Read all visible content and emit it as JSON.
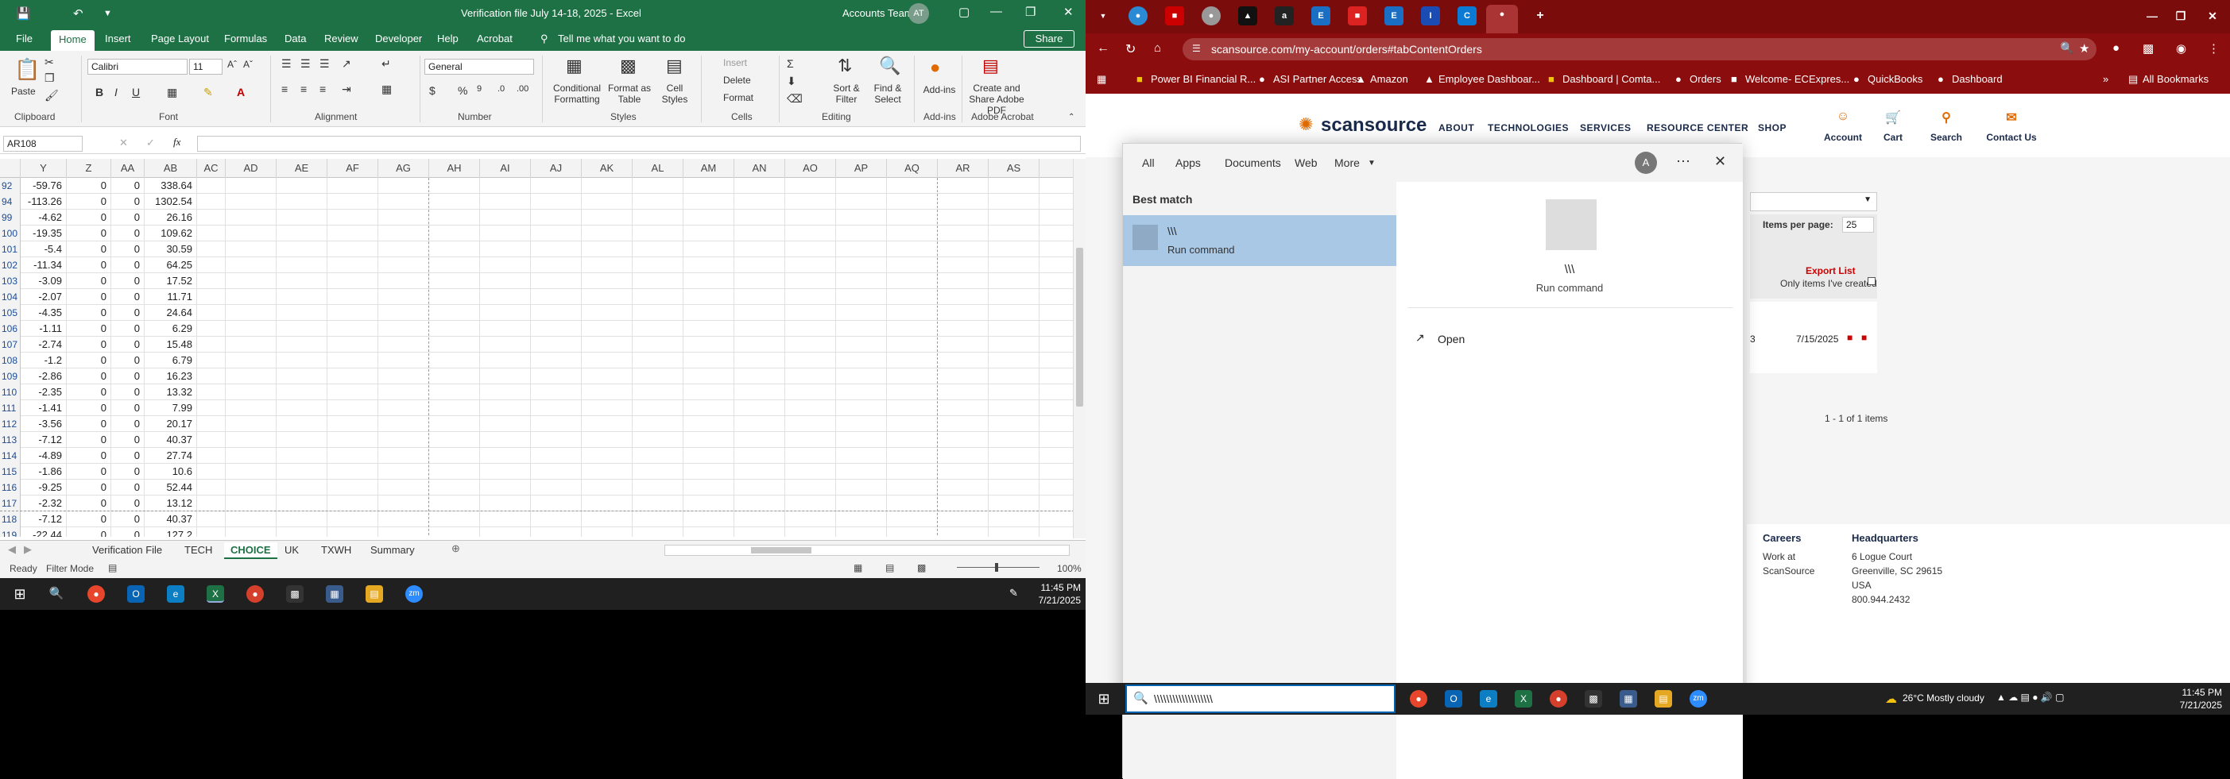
{
  "excel": {
    "title": "Verification file July 14-18, 2025  -  Excel",
    "user": "Accounts Team",
    "avatar": "AT",
    "tabs": [
      "File",
      "Home",
      "Insert",
      "Page Layout",
      "Formulas",
      "Data",
      "Review",
      "Developer",
      "Help",
      "Acrobat"
    ],
    "tell_me": "Tell me what you want to do",
    "share": "Share",
    "ribbon": {
      "font_name": "Calibri",
      "font_size": "11",
      "number_format": "General",
      "groups": [
        "Clipboard",
        "Font",
        "Alignment",
        "Number",
        "Styles",
        "Cells",
        "Editing",
        "Add-ins",
        "Adobe Acrobat"
      ],
      "paste": "Paste",
      "conditional": "Conditional Formatting",
      "format_as_table": "Format as Table",
      "cell_styles": "Cell Styles",
      "insert": "Insert",
      "delete": "Delete",
      "format": "Format",
      "sort_filter": "Sort & Filter",
      "find_select": "Find & Select",
      "addins": "Add-ins",
      "create_pdf": "Create and Share Adobe PDF"
    },
    "name_box": "AR108",
    "columns": [
      "Y",
      "Z",
      "AA",
      "AB",
      "AC",
      "AD",
      "AE",
      "AF",
      "AG",
      "AH",
      "AI",
      "AJ",
      "AK",
      "AL",
      "AM",
      "AN",
      "AO",
      "AP",
      "AQ",
      "AR",
      "AS"
    ],
    "rows": [
      {
        "n": "92",
        "y": "-59.76",
        "z": "0",
        "aa": "0",
        "ab": "338.64"
      },
      {
        "n": "94",
        "y": "-113.26",
        "z": "0",
        "aa": "0",
        "ab": "1302.54"
      },
      {
        "n": "99",
        "y": "-4.62",
        "z": "0",
        "aa": "0",
        "ab": "26.16"
      },
      {
        "n": "100",
        "y": "-19.35",
        "z": "0",
        "aa": "0",
        "ab": "109.62"
      },
      {
        "n": "101",
        "y": "-5.4",
        "z": "0",
        "aa": "0",
        "ab": "30.59"
      },
      {
        "n": "102",
        "y": "-11.34",
        "z": "0",
        "aa": "0",
        "ab": "64.25"
      },
      {
        "n": "103",
        "y": "-3.09",
        "z": "0",
        "aa": "0",
        "ab": "17.52"
      },
      {
        "n": "104",
        "y": "-2.07",
        "z": "0",
        "aa": "0",
        "ab": "11.71"
      },
      {
        "n": "105",
        "y": "-4.35",
        "z": "0",
        "aa": "0",
        "ab": "24.64"
      },
      {
        "n": "106",
        "y": "-1.11",
        "z": "0",
        "aa": "0",
        "ab": "6.29"
      },
      {
        "n": "107",
        "y": "-2.74",
        "z": "0",
        "aa": "0",
        "ab": "15.48"
      },
      {
        "n": "108",
        "y": "-1.2",
        "z": "0",
        "aa": "0",
        "ab": "6.79"
      },
      {
        "n": "109",
        "y": "-2.86",
        "z": "0",
        "aa": "0",
        "ab": "16.23"
      },
      {
        "n": "110",
        "y": "-2.35",
        "z": "0",
        "aa": "0",
        "ab": "13.32"
      },
      {
        "n": "111",
        "y": "-1.41",
        "z": "0",
        "aa": "0",
        "ab": "7.99"
      },
      {
        "n": "112",
        "y": "-3.56",
        "z": "0",
        "aa": "0",
        "ab": "20.17"
      },
      {
        "n": "113",
        "y": "-7.12",
        "z": "0",
        "aa": "0",
        "ab": "40.37"
      },
      {
        "n": "114",
        "y": "-4.89",
        "z": "0",
        "aa": "0",
        "ab": "27.74"
      },
      {
        "n": "115",
        "y": "-1.86",
        "z": "0",
        "aa": "0",
        "ab": "10.6"
      },
      {
        "n": "116",
        "y": "-9.25",
        "z": "0",
        "aa": "0",
        "ab": "52.44"
      },
      {
        "n": "117",
        "y": "-2.32",
        "z": "0",
        "aa": "0",
        "ab": "13.12"
      },
      {
        "n": "118",
        "y": "-7.12",
        "z": "0",
        "aa": "0",
        "ab": "40.37"
      },
      {
        "n": "119",
        "y": "-22.44",
        "z": "0",
        "aa": "0",
        "ab": "127.2"
      }
    ],
    "sheets": [
      "Verification File",
      "TECH",
      "CHOICE",
      "UK",
      "TXWH",
      "Summary"
    ],
    "active_sheet": "CHOICE",
    "status_ready": "Ready",
    "status_filter": "Filter Mode",
    "zoom": "100%",
    "clock_time": "11:45 PM",
    "clock_date": "7/21/2025"
  },
  "chrome": {
    "url": "scansource.com/my-account/orders#tabContentOrders",
    "bookmarks": [
      "Power BI Financial R...",
      "ASI Partner Access",
      "Amazon",
      "Employee Dashboar...",
      "Dashboard | Comta...",
      "Orders",
      "Welcome- ECExpres...",
      "QuickBooks",
      "Dashboard"
    ],
    "all_bookmarks": "All Bookmarks",
    "site": {
      "logo": "scansource",
      "nav": [
        "ABOUT",
        "TECHNOLOGIES",
        "SERVICES",
        "RESOURCE CENTER",
        "SHOP"
      ],
      "icons": [
        "Account",
        "Cart",
        "Search",
        "Contact Us"
      ],
      "items_per_page_label": "Items per page:",
      "items_per_page": "25",
      "export": "Export List",
      "only_items": "Only items I've created",
      "order_num_tail": "3",
      "order_date": "7/15/2025",
      "pagination": "1 - 1 of 1 items",
      "careers": "Careers",
      "work_at": "Work at",
      "work_at2": "ScanSource",
      "hq": "Headquarters",
      "addr1": "6 Logue Court",
      "addr2": "Greenville, SC 29615",
      "addr3": "USA",
      "phone": "800.944.2432"
    }
  },
  "start_search": {
    "filters": [
      "All",
      "Apps",
      "Documents",
      "Web",
      "More"
    ],
    "avatar": "A",
    "best_match": "Best match",
    "result_title": "\\\\\\",
    "result_subtitle": "Run command",
    "preview_title": "\\\\\\",
    "preview_subtitle": "Run command",
    "open": "Open",
    "query": "\\\\\\\\\\\\\\\\\\\\\\\\\\\\\\\\\\\\\\"
  },
  "taskbar_right": {
    "weather": "26°C  Mostly cloudy",
    "time": "11:45 PM",
    "date": "7/21/2025"
  }
}
